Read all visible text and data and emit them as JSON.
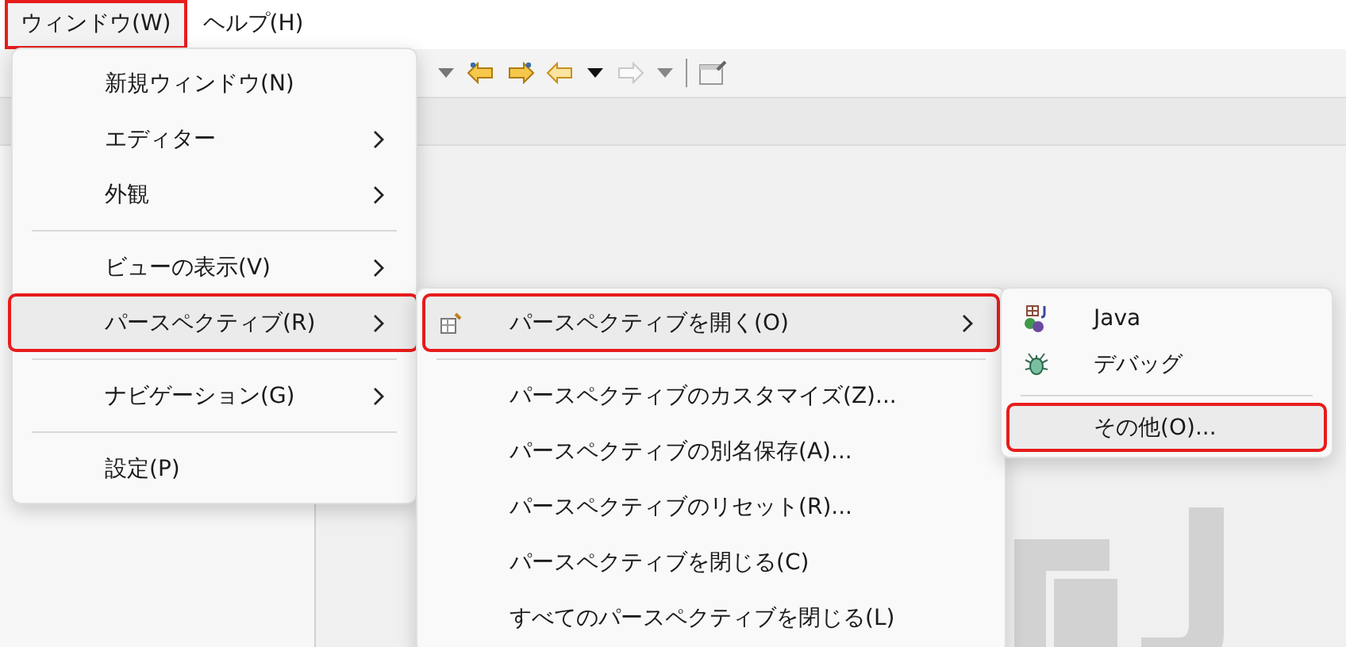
{
  "menubar": [
    {
      "label": "ウィンドウ(W)",
      "selected": true,
      "highlighted": true
    },
    {
      "label": "ヘルプ(H)",
      "selected": false,
      "highlighted": false
    }
  ],
  "window_menu": [
    {
      "kind": "item",
      "label": "新規ウィンドウ(N)",
      "submenu": false,
      "selected": false,
      "highlighted": false
    },
    {
      "kind": "item",
      "label": "エディター",
      "submenu": true,
      "selected": false,
      "highlighted": false
    },
    {
      "kind": "item",
      "label": "外観",
      "submenu": true,
      "selected": false,
      "highlighted": false
    },
    {
      "kind": "separator"
    },
    {
      "kind": "item",
      "label": "ビューの表示(V)",
      "submenu": true,
      "selected": false,
      "highlighted": false
    },
    {
      "kind": "item",
      "label": "パースペクティブ(R)",
      "submenu": true,
      "selected": true,
      "highlighted": true
    },
    {
      "kind": "separator"
    },
    {
      "kind": "item",
      "label": "ナビゲーション(G)",
      "submenu": true,
      "selected": false,
      "highlighted": false
    },
    {
      "kind": "separator"
    },
    {
      "kind": "item",
      "label": "設定(P)",
      "submenu": false,
      "selected": false,
      "highlighted": false
    }
  ],
  "perspective_menu": [
    {
      "kind": "open-item",
      "label": "パースペクティブを開く(O)",
      "submenu": true,
      "selected": true,
      "highlighted": true
    },
    {
      "kind": "separator"
    },
    {
      "kind": "item",
      "label": "パースペクティブのカスタマイズ(Z)...",
      "submenu": false,
      "selected": false,
      "highlighted": false
    },
    {
      "kind": "item",
      "label": "パースペクティブの別名保存(A)...",
      "submenu": false,
      "selected": false,
      "highlighted": false
    },
    {
      "kind": "item",
      "label": "パースペクティブのリセット(R)...",
      "submenu": false,
      "selected": false,
      "highlighted": false
    },
    {
      "kind": "item",
      "label": "パースペクティブを閉じる(C)",
      "submenu": false,
      "selected": false,
      "highlighted": false
    },
    {
      "kind": "item",
      "label": "すべてのパースペクティブを閉じる(L)",
      "submenu": false,
      "selected": false,
      "highlighted": false
    }
  ],
  "open_perspective_menu": [
    {
      "kind": "java-item",
      "label": "Java",
      "submenu": false,
      "selected": false,
      "highlighted": false
    },
    {
      "kind": "debug-item",
      "label": "デバッグ",
      "submenu": false,
      "selected": false,
      "highlighted": false
    },
    {
      "kind": "separator"
    },
    {
      "kind": "item",
      "label": "その他(O)...",
      "submenu": false,
      "selected": true,
      "highlighted": true
    }
  ]
}
